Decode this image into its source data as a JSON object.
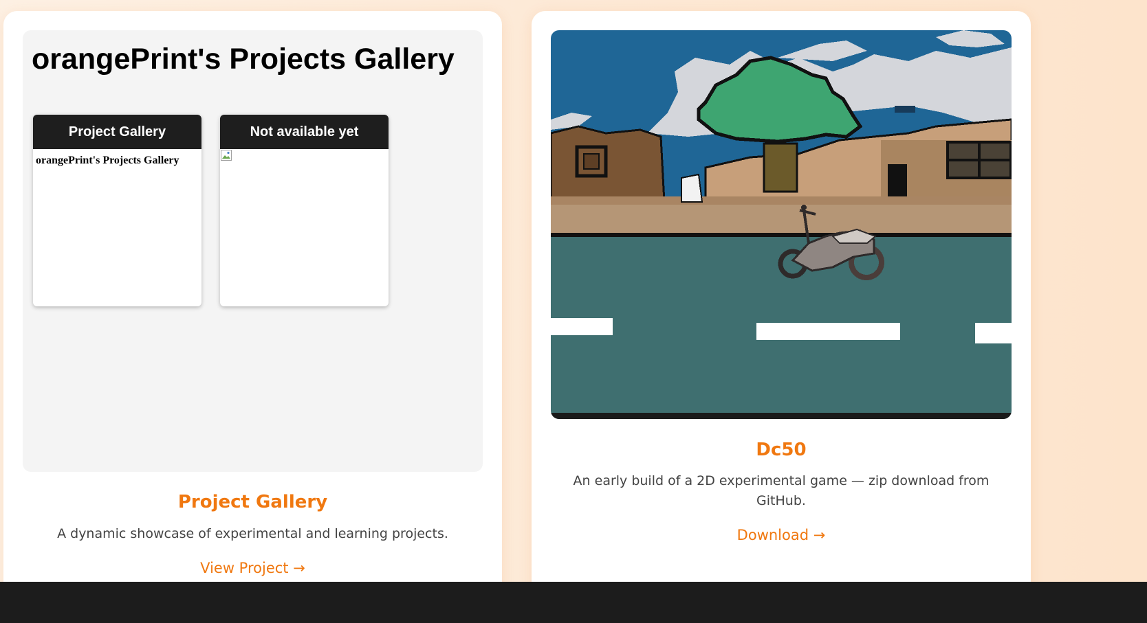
{
  "projects": [
    {
      "preview": {
        "title": "orangePrint's Projects Gallery",
        "mini_cards": [
          {
            "header": "Project Gallery",
            "body_text": "orangePrint's Projects Gallery"
          },
          {
            "header": "Not available yet",
            "body_text": ""
          }
        ]
      },
      "title": "Project Gallery",
      "description": "A dynamic showcase of experimental and learning projects.",
      "link_label": "View Project →"
    },
    {
      "image_icon": "pixel-art-motorbike-street-scene",
      "title": "Dc50",
      "description": "An early build of a 2D experimental game — zip download from GitHub.",
      "link_label": "Download →"
    }
  ],
  "colors": {
    "accent": "#f07810",
    "page_background": "#fdebd8",
    "card_background": "#ffffff",
    "preview_background": "#f4f4f4",
    "mini_header": "#1e1e1e",
    "sky": "#1f6696",
    "road": "#3f6f70"
  }
}
